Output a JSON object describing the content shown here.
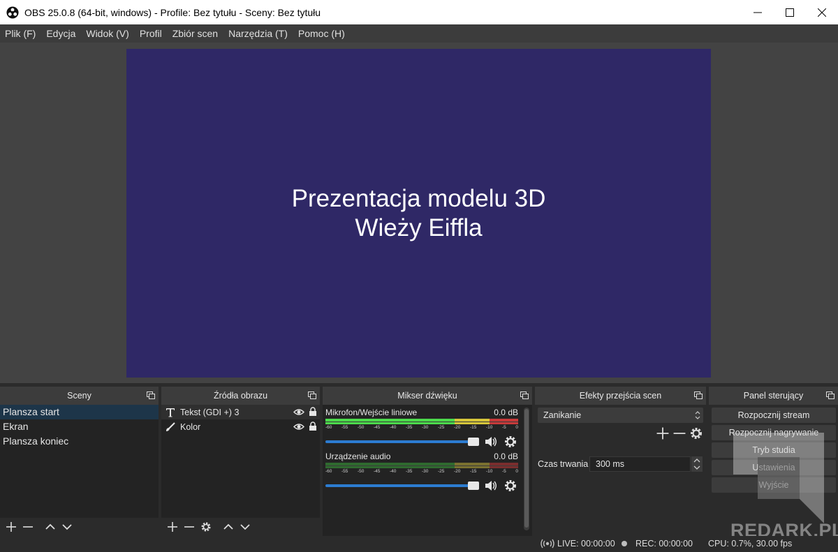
{
  "window": {
    "title": "OBS 25.0.8 (64-bit, windows) - Profile: Bez tytułu - Sceny: Bez tytułu"
  },
  "menu": [
    "Plik (F)",
    "Edycja",
    "Widok (V)",
    "Profil",
    "Zbiór scen",
    "Narzędzia (T)",
    "Pomoc (H)"
  ],
  "preview": {
    "line1": "Prezentacja modelu 3D",
    "line2": "Wieży Eiffla",
    "background": "#2f2866"
  },
  "scenes": {
    "title": "Sceny",
    "items": [
      "Plansza start",
      "Ekran",
      "Plansza koniec"
    ],
    "selected": "Plansza start"
  },
  "sources": {
    "title": "Źródła obrazu",
    "items": [
      {
        "label": "Tekst (GDI +) 3",
        "icon": "text-icon"
      },
      {
        "label": "Kolor",
        "icon": "brush-icon"
      }
    ]
  },
  "mixer": {
    "title": "Mikser dźwięku",
    "channels": [
      {
        "name": "Mikrofon/Wejście liniowe",
        "level": "0.0 dB",
        "volume": 1.0
      },
      {
        "name": "Urządzenie audio",
        "level": "0.0 dB",
        "volume": 1.0
      }
    ],
    "ticks": [
      "-60",
      "-55",
      "-50",
      "-45",
      "-40",
      "-35",
      "-30",
      "-25",
      "-20",
      "-15",
      "-10",
      "-5",
      "0"
    ]
  },
  "transitions": {
    "title": "Efekty przejścia scen",
    "selected": "Zanikanie",
    "duration_label": "Czas trwania",
    "duration_value": "300 ms"
  },
  "controls": {
    "title": "Panel sterujący",
    "buttons": [
      "Rozpocznij stream",
      "Rozpocznij nagrywanie",
      "Tryb studia",
      "Ustawienia",
      "Wyjście"
    ]
  },
  "status": {
    "live": "LIVE: 00:00:00",
    "rec": "REC: 00:00:00",
    "cpu": "CPU: 0.7%, 30.00 fps"
  },
  "watermark": "REDARK.PL",
  "colors": {
    "accent": "#2c7cd1",
    "meter_green": "#4cdb4c",
    "meter_yellow": "#d6c63a",
    "meter_red": "#c83a3a"
  }
}
